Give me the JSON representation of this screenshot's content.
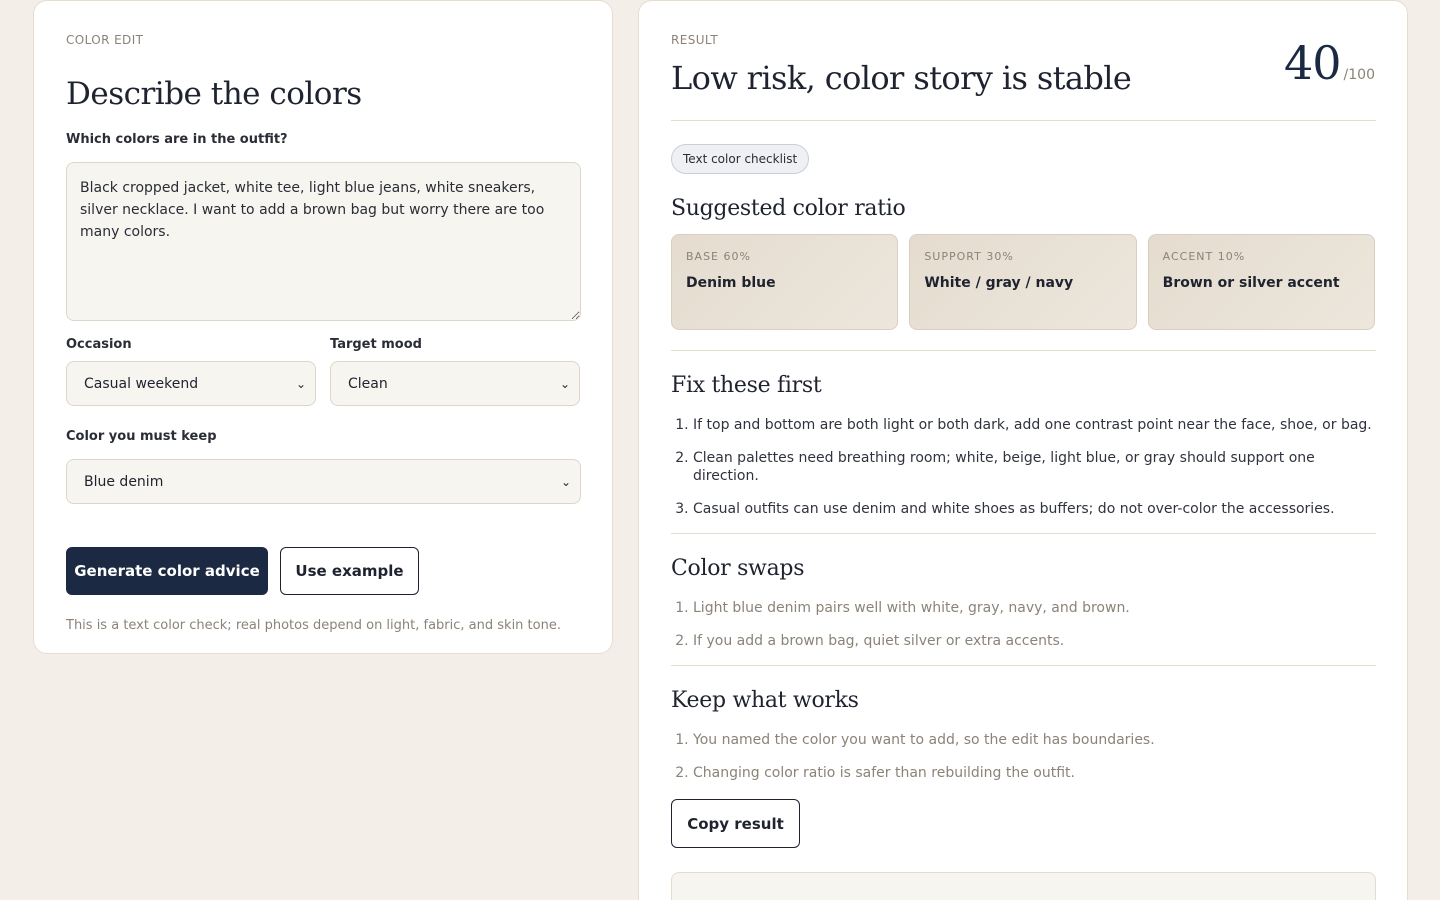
{
  "editor": {
    "eyebrow": "COLOR EDIT",
    "title": "Describe the colors",
    "question_label": "Which colors are in the outfit?",
    "outfit_text": "Black cropped jacket, white tee, light blue jeans, white sneakers, silver necklace. I want to add a brown bag but worry there are too many colors.",
    "occasion_label": "Occasion",
    "occasion_value": "Casual weekend",
    "mood_label": "Target mood",
    "mood_value": "Clean",
    "keep_label": "Color you must keep",
    "keep_value": "Blue denim",
    "generate_label": "Generate color advice",
    "example_label": "Use example",
    "note": "This is a text color check; real photos depend on light, fabric, and skin tone."
  },
  "result": {
    "eyebrow": "RESULT",
    "title": "Low risk, color story is stable",
    "score": "40",
    "score_max": "/100",
    "chip": "Text color checklist",
    "ratio_title": "Suggested color ratio",
    "ratios": [
      {
        "tag": "BASE 60%",
        "value": "Denim blue"
      },
      {
        "tag": "SUPPORT 30%",
        "value": "White / gray / navy"
      },
      {
        "tag": "ACCENT 10%",
        "value": "Brown or silver accent"
      }
    ],
    "fix_title": "Fix these first",
    "fix_items": [
      "If top and bottom are both light or both dark, add one contrast point near the face, shoe, or bag.",
      "Clean palettes need breathing room; white, beige, light blue, or gray should support one direction.",
      "Casual outfits can use denim and white shoes as buffers; do not over-color the accessories."
    ],
    "swaps_title": "Color swaps",
    "swap_items": [
      "Light blue denim pairs well with white, gray, navy, and brown.",
      "If you add a brown bag, quiet silver or extra accents."
    ],
    "keep_title": "Keep what works",
    "keep_items": [
      "You named the color you want to add, so the edit has boundaries.",
      "Changing color ratio is safer than rebuilding the outfit."
    ],
    "copy_label": "Copy result"
  },
  "colors": {
    "background": "#f3eee7",
    "primary_button": "#1c2942",
    "ratio_card": "#e8e0d4",
    "muted_text": "#8b8377"
  }
}
